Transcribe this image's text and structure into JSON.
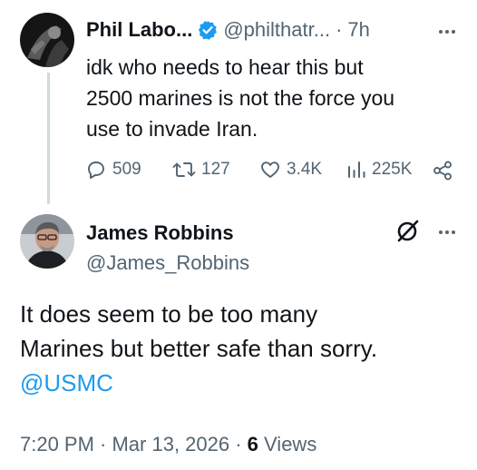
{
  "quoted_tweet": {
    "display_name": "Phil Labo...",
    "handle": "@philthatr...",
    "separator": "·",
    "time": "7h",
    "text_lines": [
      "idk who needs to hear this but",
      "2500 marines is not the force you",
      "use to invade Iran."
    ],
    "metrics": {
      "replies": "509",
      "reposts": "127",
      "likes": "3.4K",
      "views": "225K"
    }
  },
  "reply_tweet": {
    "display_name": "James Robbins",
    "handle": "@James_Robbins",
    "text_lines": [
      "It does seem to be too many",
      "Marines but better safe than sorry."
    ],
    "mention": "@USMC",
    "timestamp": "7:20 PM · Mar 13, 2026 · ",
    "views_count": "6",
    "views_label": " Views"
  },
  "colors": {
    "verified_badge": "#1d9bf0",
    "mention": "#1d9bf0",
    "secondary_text": "#536471"
  },
  "icons": [
    "verified-badge-icon",
    "more-icon",
    "reply-icon",
    "repost-icon",
    "like-icon",
    "views-icon",
    "share-icon",
    "grok-icon"
  ]
}
